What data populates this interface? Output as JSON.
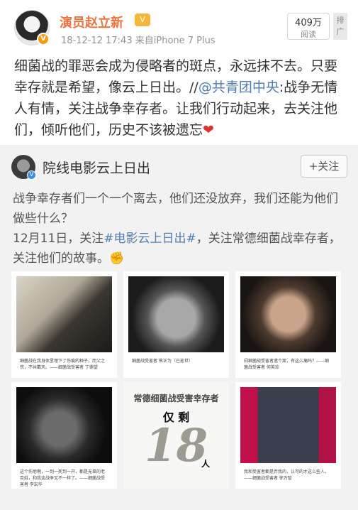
{
  "post": {
    "username": "演员赵立新",
    "vip_badge": "V",
    "verified_mark": "V",
    "timestamp": "18-12-12 17:43",
    "source": "来自iPhone 7 Plus",
    "reads_count": "409万",
    "reads_label": "阅读",
    "rank_label": "排广",
    "text_part1": "细菌战的罪恶会成为侵略者的斑点，永远抹不去。只要幸存就是希望，像云上日出。//",
    "mention": "@共青团中央",
    "text_part2": ":战争无情人有情，关注战争幸存者。让我们行动起来，去关注他们，倾听他们，历史不该被遗忘",
    "heart": "❤"
  },
  "repost": {
    "name": "院线电影云上日出",
    "verified_mark": "V",
    "follow_label": "+关注",
    "text_line1": "战争幸存者们一个一个离去，他们还没放弃，我们还能为他们做些什么？",
    "text_prefix": "12月11日，关注",
    "hashtag": "#电影云上日出#",
    "text_suffix": "，关注常德细菌战幸存者，关注他们的故事。",
    "fist": "✊",
    "tiles": [
      {
        "caption": "细菌战在我身体里埋下了伤痕的种子，而父之伤，不共戴天。——细菌战受害者 丁德望"
      },
      {
        "caption": "细菌战受害者 熊正为（已逝世）"
      },
      {
        "caption": "闷细菌战受害者遗个案，有这么痛吗？——细菌战受害者 何英珍"
      },
      {
        "caption": "这个伤疤啊，一到一死到一开，都是无辜的老百姓，和我这战争又不一样了。——细菌战受害者 李宏华"
      },
      {
        "title": "常德细菌战受害幸存者",
        "only": "仅 剩",
        "number": "18",
        "unit": "人"
      },
      {
        "caption": "我和受害者都是弃我的，认可的才这么些人。——细菌战受害者 徐万智"
      }
    ]
  }
}
